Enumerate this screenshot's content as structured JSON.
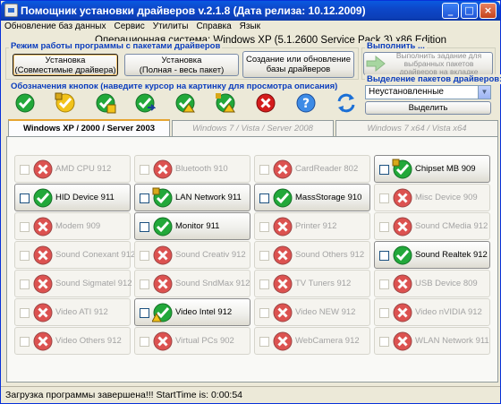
{
  "window": {
    "title": "Помощник установки драйверов v.2.1.8 (Дата релиза: 10.12.2009)",
    "controls": [
      "_",
      "□",
      "×"
    ]
  },
  "menu": [
    "Обновление баз данных",
    "Сервис",
    "Утилиты",
    "Справка",
    "Язык"
  ],
  "os_label": "Операционная система: Windows XP  (5.1.2600 Service Pack 3) x86 Edition",
  "modes": {
    "title": "Режим работы программы с пакетами драйверов",
    "buttons": [
      {
        "label1": "Установка",
        "label2": "(Совместимые драйвера)"
      },
      {
        "label1": "Установка",
        "label2": "(Полная - весь пакет)"
      },
      {
        "label1": "Создание или обновление",
        "label2": "базы драйверов"
      }
    ]
  },
  "execute": {
    "title": "Выполнить ...",
    "button": "Выполнить задание для выбранных пакетов драйверов на вкладке"
  },
  "legend_title": "Обозначения кнопок (наведите курсор на картинку для просмотра описания)",
  "legend_icons": [
    "check-icon",
    "warning-check-icon",
    "check-box-icon",
    "check-arrow-icon",
    "warning-box-icon",
    "warning-arrow-icon",
    "cross-icon",
    "help-icon",
    "refresh-icon"
  ],
  "selection": {
    "title": "Выделение пакетов драйверов:",
    "combo_value": "Неустановленные",
    "select_button": "Выделить"
  },
  "tabs": [
    "Windows XP / 2000 / Server 2003",
    "Windows 7 / Vista / Server 2008",
    "Windows 7 x64 / Vista x64"
  ],
  "drivers": [
    {
      "name": "AMD CPU 912",
      "state": "off"
    },
    {
      "name": "Bluetooth 910",
      "state": "off"
    },
    {
      "name": "CardReader 802",
      "state": "off"
    },
    {
      "name": "Chipset MB 909",
      "state": "on",
      "icon": "check-box"
    },
    {
      "name": "HID Device 911",
      "state": "on",
      "icon": "check"
    },
    {
      "name": "LAN Network 911",
      "state": "on",
      "icon": "check-box"
    },
    {
      "name": "MassStorage 910",
      "state": "on",
      "icon": "check"
    },
    {
      "name": "Misc Device 909",
      "state": "off"
    },
    {
      "name": "Modem 909",
      "state": "off"
    },
    {
      "name": "Monitor 911",
      "state": "on",
      "icon": "check"
    },
    {
      "name": "Printer 912",
      "state": "off"
    },
    {
      "name": "Sound CMedia 912",
      "state": "off"
    },
    {
      "name": "Sound Conexant 912",
      "state": "off"
    },
    {
      "name": "Sound Creativ 912",
      "state": "off"
    },
    {
      "name": "Sound Others 912",
      "state": "off"
    },
    {
      "name": "Sound Realtek 912",
      "state": "on",
      "icon": "check"
    },
    {
      "name": "Sound Sigmatel 912",
      "state": "off"
    },
    {
      "name": "Sound SndMax 912",
      "state": "off"
    },
    {
      "name": "TV Tuners 912",
      "state": "off"
    },
    {
      "name": "USB Device 809",
      "state": "off"
    },
    {
      "name": "Video ATI 912",
      "state": "off"
    },
    {
      "name": "Video Intel 912",
      "state": "on",
      "icon": "check-warn"
    },
    {
      "name": "Video NEW 912",
      "state": "off"
    },
    {
      "name": "Video nVIDIA 912",
      "state": "off"
    },
    {
      "name": "Video Others 912",
      "state": "off"
    },
    {
      "name": "Virtual PCs 902",
      "state": "off"
    },
    {
      "name": "WebCamera 912",
      "state": "off"
    },
    {
      "name": "WLAN Network 911",
      "state": "off"
    }
  ],
  "status": "Загрузка программы завершена!!! StartTime is: 0:00:54",
  "colors": {
    "title_bar": "#0c3fb8",
    "group_title": "#0a3cbd",
    "check_green": "#22a83a",
    "cross_red": "#d41c1c",
    "warn_yellow": "#f2c31a"
  }
}
